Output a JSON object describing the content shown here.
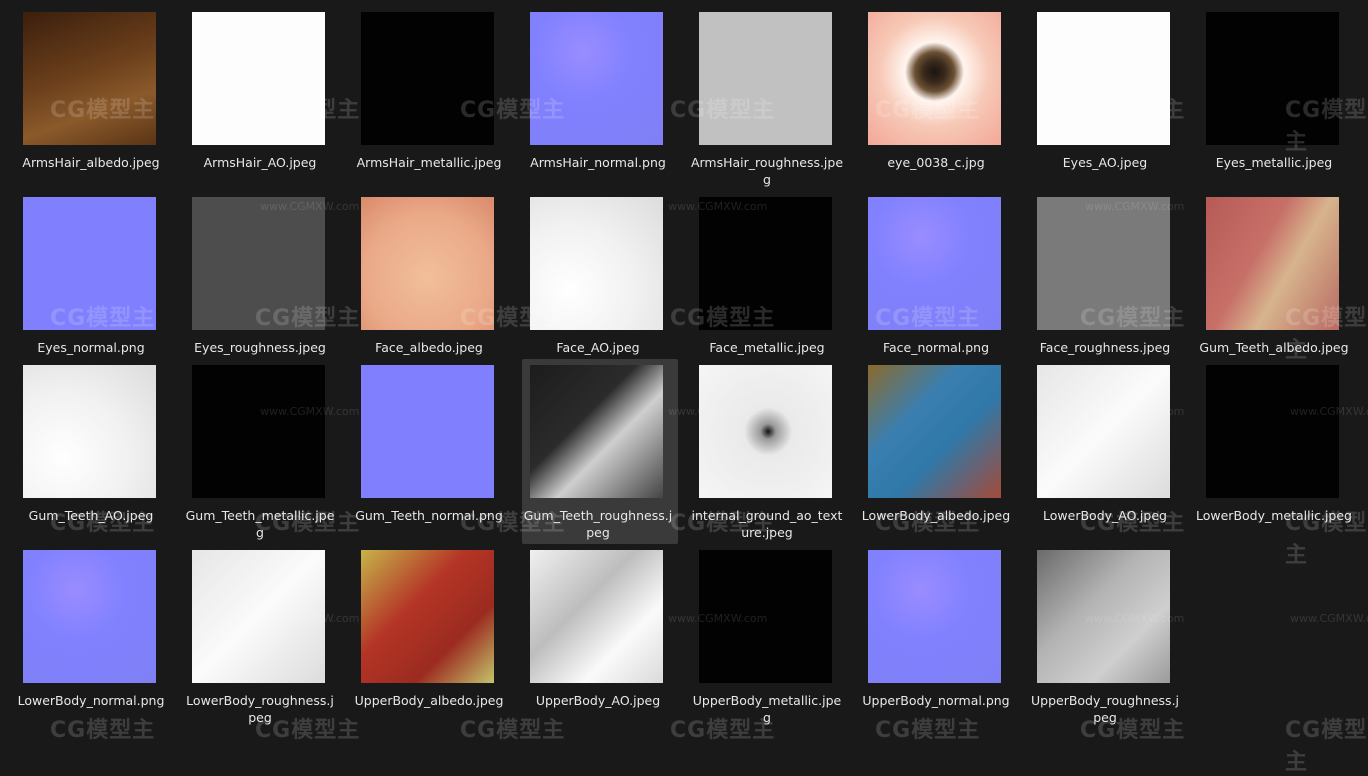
{
  "watermark": {
    "logo": "CG模型主",
    "url": "www.CGMXW.com"
  },
  "files": [
    {
      "lines": [
        "ArmsHair_albedo.jpeg"
      ],
      "tex": "t-brown",
      "col": 0,
      "row": 0
    },
    {
      "lines": [
        "ArmsHair_AO.jpeg"
      ],
      "tex": "t-white",
      "col": 1,
      "row": 0
    },
    {
      "lines": [
        "ArmsHair_metallic.jpeg"
      ],
      "tex": "t-black",
      "col": 2,
      "row": 0
    },
    {
      "lines": [
        "ArmsHair_normal.png"
      ],
      "tex": "t-normal",
      "col": 3,
      "row": 0
    },
    {
      "lines": [
        "ArmsHair_roughness.jpe",
        "g"
      ],
      "tex": "t-gray",
      "col": 4,
      "row": 0
    },
    {
      "lines": [
        "eye_0038_c.jpg"
      ],
      "tex": "t-eye",
      "col": 5,
      "row": 0
    },
    {
      "lines": [
        "Eyes_AO.jpeg"
      ],
      "tex": "t-white",
      "col": 6,
      "row": 0
    },
    {
      "lines": [
        "Eyes_metallic.jpeg"
      ],
      "tex": "t-black",
      "col": 7,
      "row": 0
    },
    {
      "lines": [
        "Eyes_normal.png"
      ],
      "tex": "t-normal2",
      "col": 0,
      "row": 1
    },
    {
      "lines": [
        "Eyes_roughness.jpeg"
      ],
      "tex": "t-dark-gray",
      "col": 1,
      "row": 1
    },
    {
      "lines": [
        "Face_albedo.jpeg"
      ],
      "tex": "t-skin",
      "col": 2,
      "row": 1
    },
    {
      "lines": [
        "Face_AO.jpeg"
      ],
      "tex": "t-ao",
      "col": 3,
      "row": 1
    },
    {
      "lines": [
        "Face_metallic.jpeg"
      ],
      "tex": "t-black",
      "col": 4,
      "row": 1
    },
    {
      "lines": [
        "Face_normal.png"
      ],
      "tex": "t-normal",
      "col": 5,
      "row": 1
    },
    {
      "lines": [
        "Face_roughness.jpeg"
      ],
      "tex": "t-midgray",
      "col": 6,
      "row": 1
    },
    {
      "lines": [
        "Gum_Teeth_albedo.jpeg"
      ],
      "tex": "t-gum",
      "col": 7,
      "row": 1
    },
    {
      "lines": [
        "Gum_Teeth_AO.jpeg"
      ],
      "tex": "t-ao",
      "col": 0,
      "row": 2
    },
    {
      "lines": [
        "Gum_Teeth_metallic.jpeg"
      ],
      "tex": "t-black",
      "col": 1,
      "row": 2
    },
    {
      "lines": [
        "Gum_Teeth_normal.png"
      ],
      "tex": "t-normal2",
      "col": 2,
      "row": 2
    },
    {
      "lines": [
        "Gum_Teeth_roughness.j",
        "peg"
      ],
      "tex": "t-rough",
      "col": 3,
      "row": 2,
      "selected": true
    },
    {
      "lines": [
        "internal_ground_ao_text",
        "ure.jpeg"
      ],
      "tex": "t-gnd",
      "col": 4,
      "row": 2
    },
    {
      "lines": [
        "LowerBody_albedo.jpeg"
      ],
      "tex": "t-lowalb",
      "col": 5,
      "row": 2
    },
    {
      "lines": [
        "LowerBody_AO.jpeg"
      ],
      "tex": "t-lowao",
      "col": 6,
      "row": 2
    },
    {
      "lines": [
        "LowerBody_metallic.jpeg"
      ],
      "tex": "t-black",
      "col": 7,
      "row": 2
    },
    {
      "lines": [
        "LowerBody_normal.png"
      ],
      "tex": "t-normal",
      "col": 0,
      "row": 3
    },
    {
      "lines": [
        "LowerBody_roughness.j",
        "peg"
      ],
      "tex": "t-lowao",
      "col": 1,
      "row": 3
    },
    {
      "lines": [
        "UpperBody_albedo.jpeg"
      ],
      "tex": "t-upalb",
      "col": 2,
      "row": 3
    },
    {
      "lines": [
        "UpperBody_AO.jpeg"
      ],
      "tex": "t-upao",
      "col": 3,
      "row": 3
    },
    {
      "lines": [
        "UpperBody_metallic.jpe",
        "g"
      ],
      "tex": "t-black",
      "col": 4,
      "row": 3
    },
    {
      "lines": [
        "UpperBody_normal.png"
      ],
      "tex": "t-normal",
      "col": 5,
      "row": 3
    },
    {
      "lines": [
        "UpperBody_roughness.j",
        "peg"
      ],
      "tex": "t-uprough",
      "col": 6,
      "row": 3
    }
  ]
}
